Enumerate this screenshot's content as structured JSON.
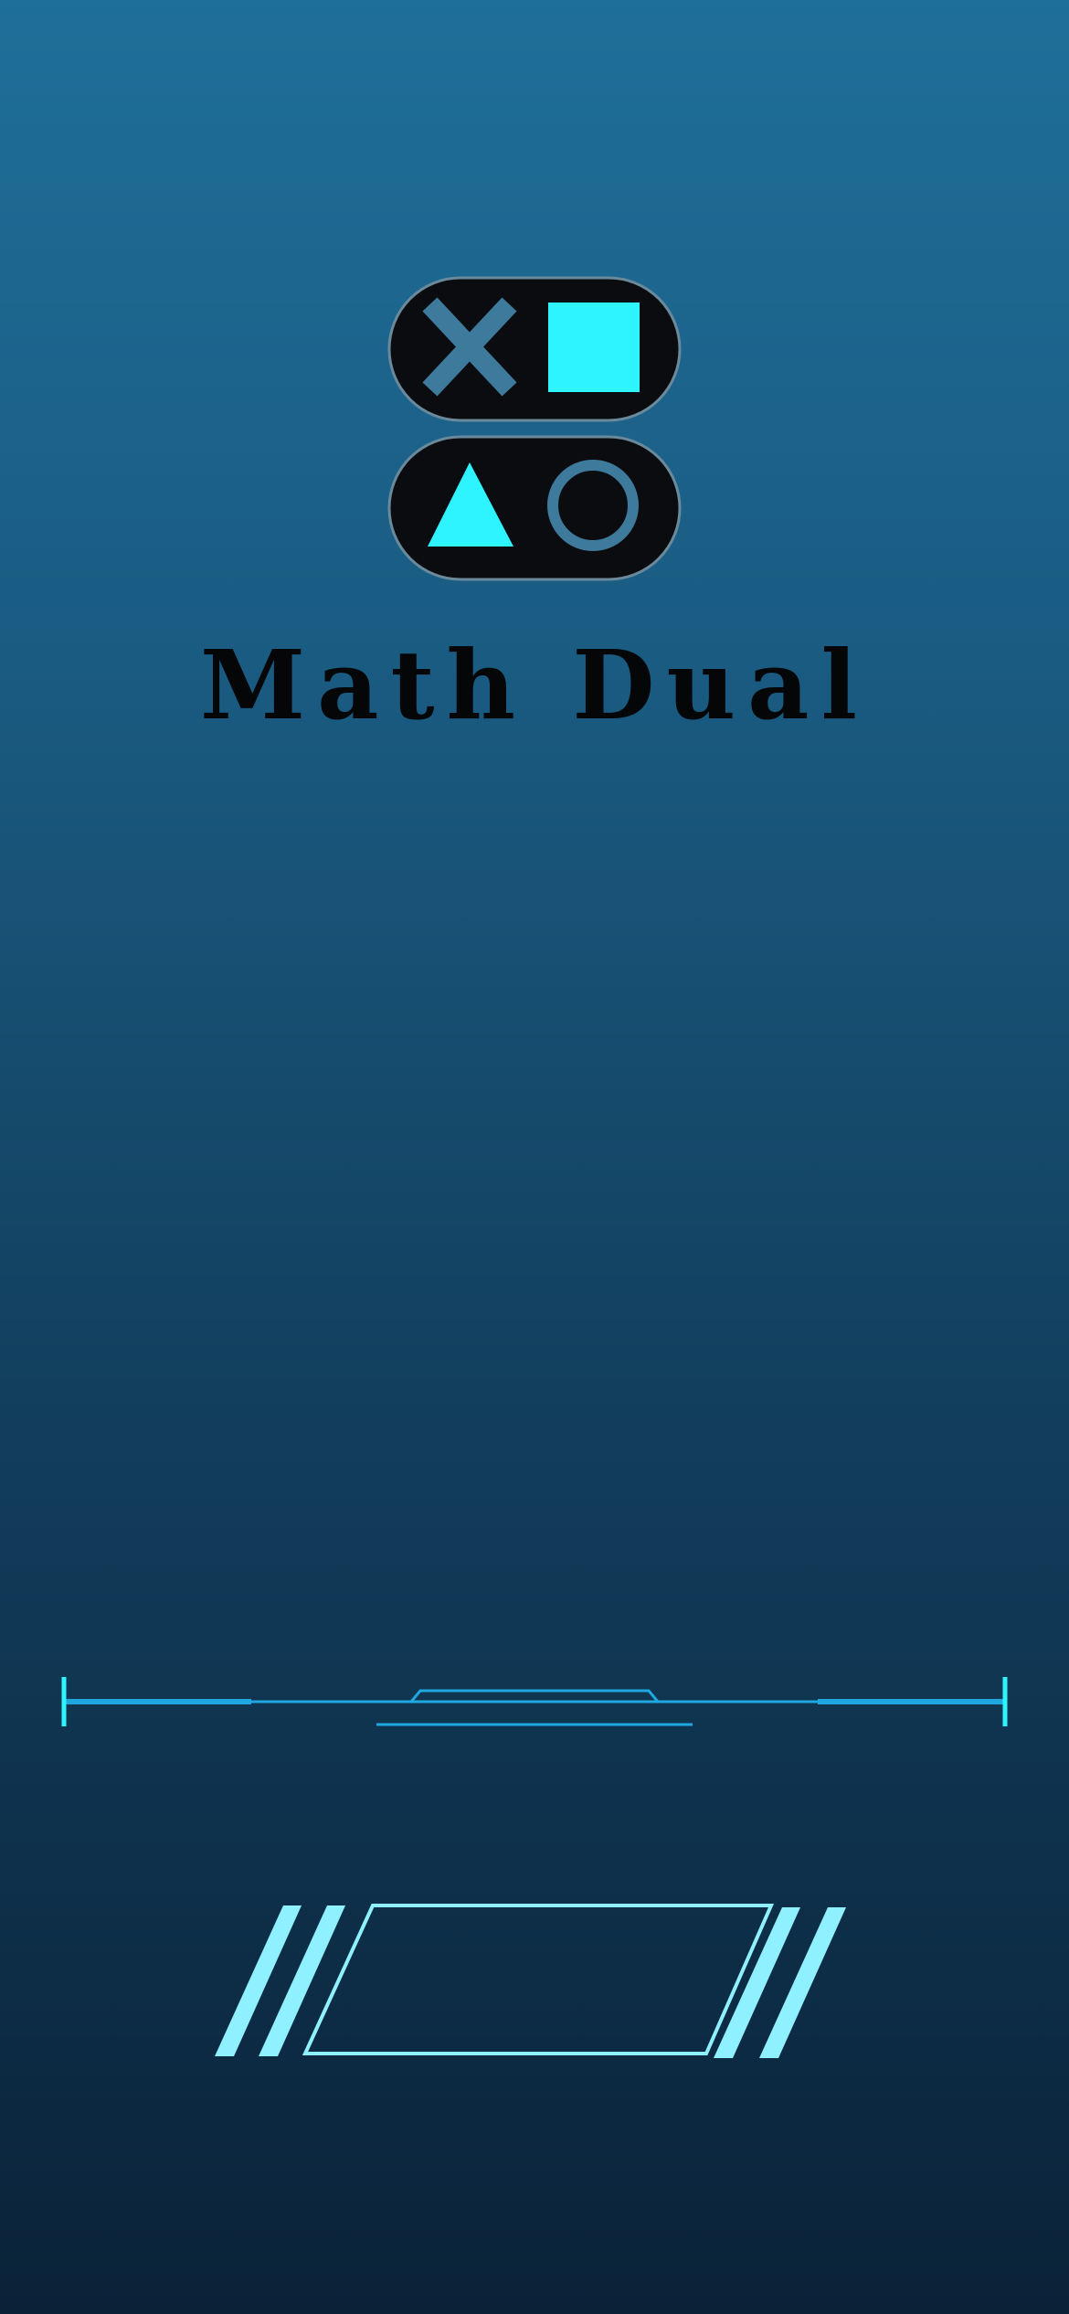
{
  "app": {
    "title": "Math Dual"
  },
  "theme": {
    "background_top": "#1e6f9a",
    "background_bottom": "#0a2238",
    "pill_color": "#0b0c10",
    "pill_border": "#6a8a9c",
    "accent_cyan": "#2df4ff",
    "muted_blue": "#3d7a9c",
    "title_color": "#040608",
    "hud_line": "#1fa7e0",
    "panel_stroke": "#8ff0ff"
  },
  "logo": {
    "icons": [
      "cross-icon",
      "square-icon",
      "triangle-icon",
      "circle-icon"
    ]
  },
  "play_panel": {
    "label": ""
  }
}
